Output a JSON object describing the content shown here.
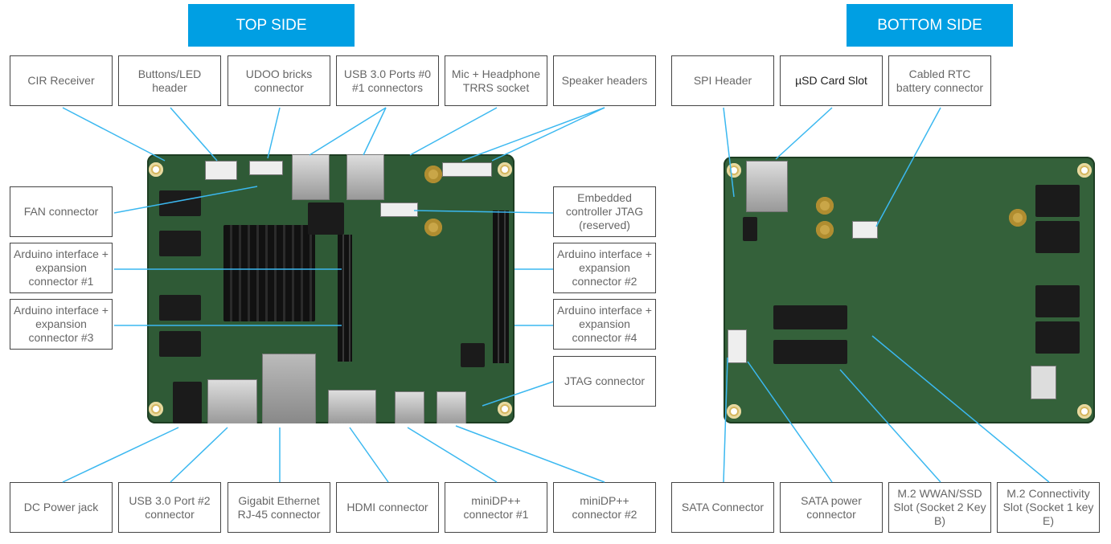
{
  "titles": {
    "top": "TOP SIDE",
    "bottom": "BOTTOM SIDE"
  },
  "top_labels": {
    "cir": "CIR Receiver",
    "buttons": "Buttons/LED header",
    "bricks": "UDOO bricks connector",
    "usb01": "USB 3.0 Ports #0 #1 connectors",
    "audio": "Mic + Headphone TRRS socket",
    "speaker": "Speaker headers",
    "fan": "FAN connector",
    "ard1": "Arduino interface + expansion connector #1",
    "ard3": "Arduino interface + expansion connector #3",
    "ecjtag": "Embedded controller JTAG (reserved)",
    "ard2": "Arduino interface + expansion connector #2",
    "ard4": "Arduino interface + expansion connector #4",
    "jtag": "JTAG connector",
    "dc": "DC Power jack",
    "usb2": "USB 3.0 Port #2 connector",
    "eth": "Gigabit Ethernet RJ-45 connector",
    "hdmi": "HDMI connector",
    "mdp1": "miniDP++ connector #1",
    "mdp2": "miniDP++ connector #2"
  },
  "bottom_labels": {
    "spi": "SPI Header",
    "sd": "µSD Card Slot",
    "rtc": "Cabled RTC battery connector",
    "sata": "SATA Connector",
    "satapwr": "SATA power connector",
    "m2b": "M.2 WWAN/SSD Slot (Socket 2 Key B)",
    "m2e": "M.2 Connectivity Slot (Socket 1 key E)"
  },
  "colors": {
    "accent": "#009fe3",
    "leader": "#3bb8f0",
    "pcb": "#2f5a36"
  }
}
